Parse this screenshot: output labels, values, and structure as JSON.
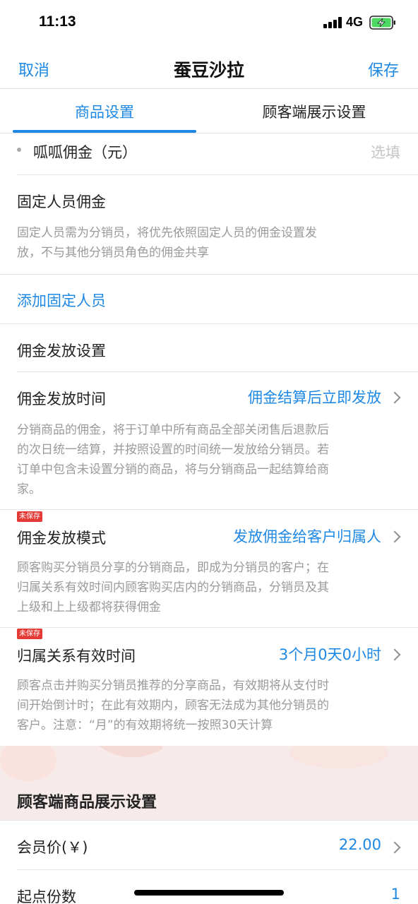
{
  "status_bar": {
    "time": "11:13",
    "network": "4G"
  },
  "nav": {
    "cancel": "取消",
    "title": "蚕豆沙拉",
    "save": "保存"
  },
  "tabs": {
    "goods": "商品设置",
    "display": "顾客端展示设置"
  },
  "rows": {
    "guagua": {
      "label": "呱呱佣金（元）",
      "placeholder": "选填"
    },
    "fixed": {
      "title": "固定人员佣金",
      "desc_line1": "固定人员需为分销员，将优先依照固定人员的佣金设置发",
      "desc_line2": "放，不与其他分销员角色的佣金共享"
    },
    "add_fixed": "添加固定人员",
    "payout_settings": "佣金发放设置",
    "payout_time": {
      "label": "佣金发放时间",
      "value": "佣金结算后立即发放",
      "desc_line1": "分销商品的佣金，将于订单中所有商品全部关闭售后退款后",
      "desc_line2": "的次日统一结算，并按照设置的时间统一发放给分销员。若",
      "desc_line3": "订单中包含未设置分销的商品，将与分销商品一起结算给商",
      "desc_line4": "家。"
    },
    "payout_mode": {
      "badge": "未保存",
      "label": "佣金发放模式",
      "value": "发放佣金给客户归属人",
      "desc_line1": "顾客购买分销员分享的分销商品，即成为分销员的客户；在",
      "desc_line2": "归属关系有效时间内顾客购买店内的分销商品，分销员及其",
      "desc_line3": "上级和上上级都将获得佣金"
    },
    "attribution": {
      "badge": "未保存",
      "label": "归属关系有效时间",
      "value": "3个月0天0小时",
      "desc_line1": "顾客点击并购买分销员推荐的分享商品，有效期将从支付时",
      "desc_line2": "间开始倒计时；在此有效期内，顾客无法成为其他分销员的",
      "desc_line3": "客户。注意：“月”的有效期将统一按照30天计算"
    }
  },
  "display_section": {
    "title": "顾客端商品展示设置"
  },
  "member_price": {
    "label": "会员价(￥)",
    "value": "22.00"
  },
  "start_qty": {
    "label": "起点份数",
    "value": "1"
  },
  "colors": {
    "accent": "#1e88e5",
    "badge": "#e53935",
    "battery": "#4cd964"
  },
  "icons": [
    "signal-icon",
    "battery-charging-icon",
    "chevron-right-icon",
    "home-indicator"
  ]
}
